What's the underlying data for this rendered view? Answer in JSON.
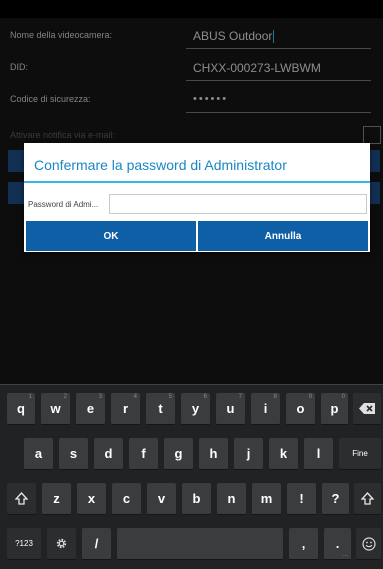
{
  "form": {
    "camera_name_label": "Nome della videocamera:",
    "camera_name_value": "ABUS Outdoor",
    "did_label": "DID:",
    "did_value": "CHXX-000273-LWBWM",
    "security_code_label": "Codice di sicurezza:",
    "security_code_value": "••••••",
    "email_notify_label": "Attivare notifica via e-mail:"
  },
  "dialog": {
    "title": "Confermare la password di Administrator",
    "password_label": "Password di Admi...",
    "password_value": "",
    "ok_label": "OK",
    "cancel_label": "Annulla"
  },
  "keyboard": {
    "row1": [
      {
        "key": "q",
        "hint": "1"
      },
      {
        "key": "w",
        "hint": "2"
      },
      {
        "key": "e",
        "hint": "3"
      },
      {
        "key": "r",
        "hint": "4"
      },
      {
        "key": "t",
        "hint": "5"
      },
      {
        "key": "y",
        "hint": "6"
      },
      {
        "key": "u",
        "hint": "7"
      },
      {
        "key": "i",
        "hint": "8"
      },
      {
        "key": "o",
        "hint": "9"
      },
      {
        "key": "p",
        "hint": "0"
      }
    ],
    "row2": [
      "a",
      "s",
      "d",
      "f",
      "g",
      "h",
      "j",
      "k",
      "l"
    ],
    "row3": [
      "z",
      "x",
      "c",
      "v",
      "b",
      "n",
      "m",
      "!",
      "?"
    ],
    "enter_label": "Fine",
    "symbols_label": "?123",
    "slash_label": "/",
    "comma_label": ",",
    "period_label": ".",
    "period_hint": "..."
  },
  "colors": {
    "accent": "#33b5e5",
    "dialog_title": "#1a86c5",
    "button_blue": "#0e5fa5"
  }
}
